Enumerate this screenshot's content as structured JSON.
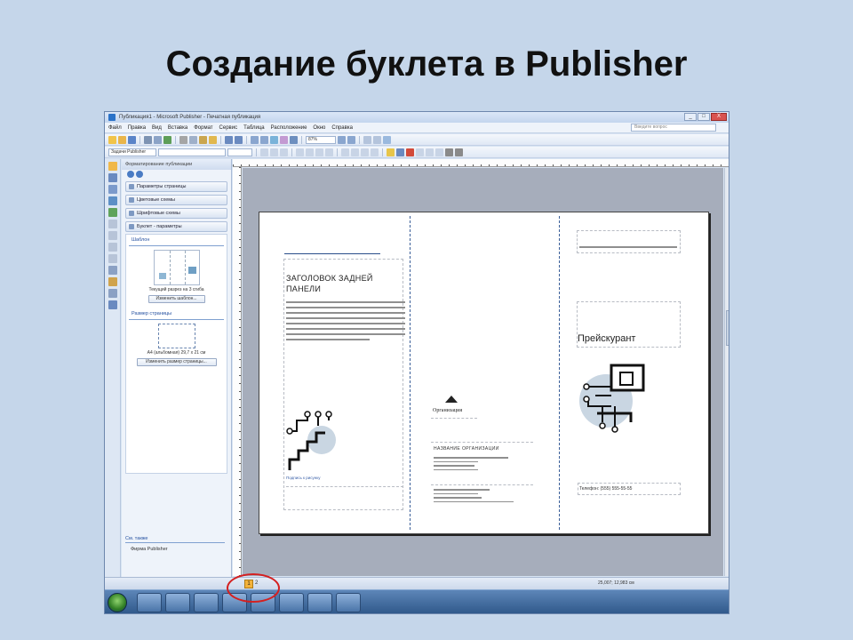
{
  "slide": {
    "title": "Создание буклета в Publisher"
  },
  "window": {
    "title": "Публикация1 - Microsoft Publisher - Печатная публикация",
    "buttons": {
      "minimize": "_",
      "maximize": "□",
      "close": "X"
    }
  },
  "menu": {
    "items": [
      "Файл",
      "Правка",
      "Вид",
      "Вставка",
      "Формат",
      "Сервис",
      "Таблица",
      "Расположение",
      "Окно",
      "Справка"
    ],
    "help_placeholder": "Введите вопрос"
  },
  "toolbar": {
    "zoom": "87%",
    "style_box": "Задачи Publisher"
  },
  "taskpane": {
    "header": "Форматирование публикации",
    "options": [
      "Параметры страницы",
      "Цветовые схемы",
      "Шрифтовые схемы",
      "Буклет - параметры"
    ],
    "template_section": "Шаблон",
    "template_caption": "Текущий разрез на 3 сгиба",
    "template_button": "Изменить шаблон...",
    "size_section": "Размер страницы",
    "size_caption": "A4 (альбомная) 29,7 x 21 см",
    "size_button": "Изменить размер страницы...",
    "footer_title": "См. также",
    "footer_link": "Фирма Publisher"
  },
  "booklet": {
    "panel1_title": "ЗАГОЛОВОК ЗАДНЕЙ ПАНЕЛИ",
    "panel1_caption": "Подпись к рисунку",
    "org_name": "Организация",
    "address_heading": "НАЗВАНИЕ ОРГАНИЗАЦИИ",
    "price_title": "Прейскурант",
    "phone": "Телефон: (555) 555-55-55"
  },
  "status": {
    "page": "1",
    "page_extra": "2",
    "coords": "25,007; 12,983 см"
  },
  "colors": {
    "slide_bg": "#c5d6ea",
    "circle_highlight": "#d42020",
    "page_badge": "#f3b23a"
  }
}
